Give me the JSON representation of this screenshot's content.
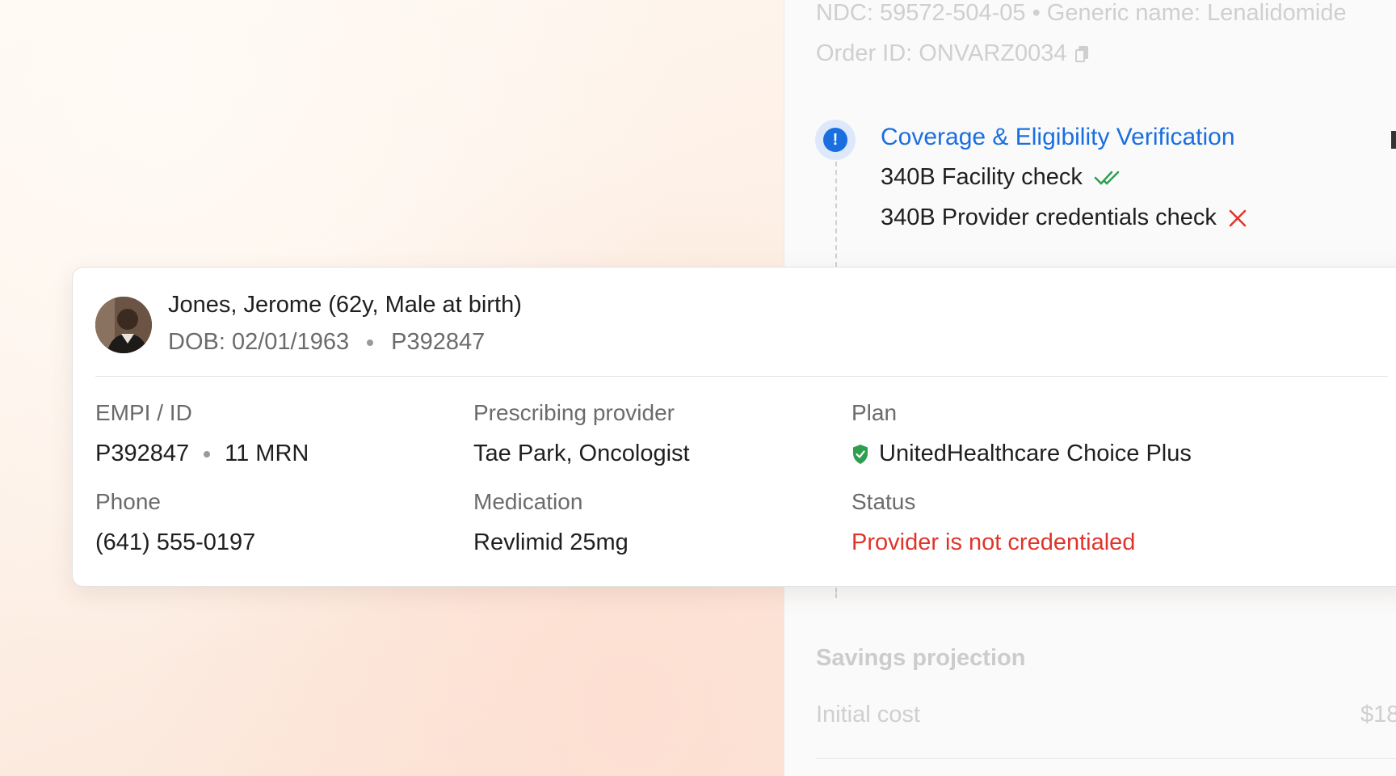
{
  "background_panel": {
    "ndc_line": "NDC: 59572-504-05 • Generic name: Lenalidomide",
    "order_id": "Order ID: ONVARZ0034",
    "coverage": {
      "title": "Coverage & Eligibility Verification",
      "checks": [
        {
          "label": "340B Facility check",
          "status": "passed"
        },
        {
          "label": "340B Provider credentials check",
          "status": "failed"
        }
      ]
    },
    "savings_title": "Savings projection",
    "initial_cost_label": "Initial cost",
    "initial_cost_value": "$18"
  },
  "patient": {
    "name": "Jones, Jerome (62y, Male at birth)",
    "dob": "DOB: 02/01/1963",
    "id": "P392847"
  },
  "details": {
    "empi_label": "EMPI / ID",
    "empi_id": "P392847",
    "mrn": "11 MRN",
    "provider_label": "Prescribing provider",
    "provider_value": "Tae Park, Oncologist",
    "plan_label": "Plan",
    "plan_value": "UnitedHealthcare Choice Plus",
    "phone_label": "Phone",
    "phone_value": "(641) 555-0197",
    "medication_label": "Medication",
    "medication_value": "Revlimid 25mg",
    "status_label": "Status",
    "status_value": "Provider is not credentialed"
  },
  "colors": {
    "accent_blue": "#1a6fe0",
    "success_green": "#2e9e4f",
    "error_red": "#e0342b"
  }
}
